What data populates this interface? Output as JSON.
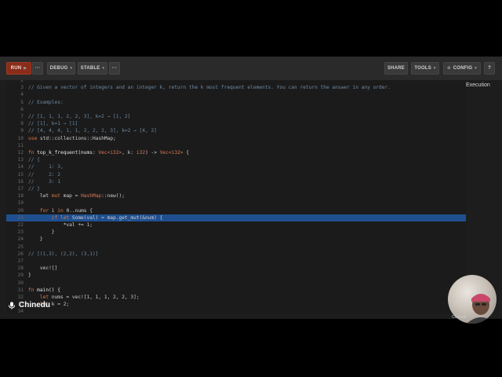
{
  "toolbar": {
    "run_label": "RUN",
    "run_icon": "play-icon",
    "more_label": "···",
    "debug_label": "DEBUG",
    "stable_label": "STABLE",
    "share_label": "SHARE",
    "tools_label": "TOOLS",
    "config_label": "CONFIG",
    "help_label": "?"
  },
  "side": {
    "execution_label": "Execution"
  },
  "participant": {
    "name": "Chinedu",
    "webcam_label": "Chinedu"
  },
  "highlighted_line": 21,
  "lines": [
    {
      "n": "2",
      "tokens": []
    },
    {
      "n": "3",
      "tokens": [
        {
          "t": "// Given a vector of integers and an integer k, return the k most frequent elements. You can return the answer in any order.",
          "c": "comment"
        }
      ]
    },
    {
      "n": "4",
      "tokens": []
    },
    {
      "n": "5",
      "tokens": [
        {
          "t": "// Examples:",
          "c": "comment"
        }
      ]
    },
    {
      "n": "6",
      "tokens": []
    },
    {
      "n": "7",
      "tokens": [
        {
          "t": "// [1, 1, 1, 2, 2, 3], k=2 → [1, 2]",
          "c": "comment"
        }
      ]
    },
    {
      "n": "8",
      "tokens": [
        {
          "t": "// [1], k=1 → [1]",
          "c": "comment"
        }
      ]
    },
    {
      "n": "9",
      "tokens": [
        {
          "t": "// [4, 4, 4, 1, 1, 2, 2, 2, 3], k=2 → [4, 2]",
          "c": "comment"
        }
      ]
    },
    {
      "n": "10",
      "tokens": [
        {
          "t": "use",
          "c": "kw"
        },
        {
          "t": " std::collections::HashMap;",
          "c": "plain"
        }
      ]
    },
    {
      "n": "11",
      "tokens": []
    },
    {
      "n": "12",
      "tokens": [
        {
          "t": "fn",
          "c": "kw"
        },
        {
          "t": " top_k_frequent(nums: ",
          "c": "fn"
        },
        {
          "t": "Vec<i32>",
          "c": "type"
        },
        {
          "t": ", k: ",
          "c": "plain"
        },
        {
          "t": "i32",
          "c": "type"
        },
        {
          "t": ") -> ",
          "c": "plain"
        },
        {
          "t": "Vec<i32>",
          "c": "type"
        },
        {
          "t": " {",
          "c": "plain"
        }
      ]
    },
    {
      "n": "13",
      "tokens": [
        {
          "t": "// {",
          "c": "comment"
        }
      ]
    },
    {
      "n": "14",
      "tokens": [
        {
          "t": "//     1: 3,",
          "c": "comment"
        }
      ]
    },
    {
      "n": "15",
      "tokens": [
        {
          "t": "//     2: 2",
          "c": "comment"
        }
      ]
    },
    {
      "n": "16",
      "tokens": [
        {
          "t": "//     3: 1",
          "c": "comment"
        }
      ]
    },
    {
      "n": "17",
      "tokens": [
        {
          "t": "// }",
          "c": "comment"
        }
      ]
    },
    {
      "n": "18",
      "tokens": [
        {
          "t": "    lwt ",
          "c": "plain"
        },
        {
          "t": "mut",
          "c": "kw"
        },
        {
          "t": " map = ",
          "c": "plain"
        },
        {
          "t": "HashMap",
          "c": "type"
        },
        {
          "t": "::new();",
          "c": "plain"
        }
      ]
    },
    {
      "n": "19",
      "tokens": []
    },
    {
      "n": "20",
      "tokens": [
        {
          "t": "    for",
          "c": "kw"
        },
        {
          "t": " i ",
          "c": "plain"
        },
        {
          "t": "in",
          "c": "kw"
        },
        {
          "t": " 0..nums {",
          "c": "plain"
        }
      ]
    },
    {
      "n": "21",
      "tokens": [
        {
          "t": "        if let",
          "c": "kw"
        },
        {
          "t": " Some(val) = map.get_mut(&num) {",
          "c": "plain"
        }
      ]
    },
    {
      "n": "22",
      "tokens": [
        {
          "t": "            *val += 1;",
          "c": "plain"
        }
      ]
    },
    {
      "n": "23",
      "tokens": [
        {
          "t": "        }",
          "c": "plain"
        }
      ]
    },
    {
      "n": "24",
      "tokens": [
        {
          "t": "    }",
          "c": "plain"
        }
      ]
    },
    {
      "n": "25",
      "tokens": []
    },
    {
      "n": "26",
      "tokens": [
        {
          "t": "// [(1,3), (2,2), (3,1)]",
          "c": "comment"
        }
      ]
    },
    {
      "n": "27",
      "tokens": []
    },
    {
      "n": "28",
      "tokens": [
        {
          "t": "    vec![]",
          "c": "plain"
        }
      ]
    },
    {
      "n": "29",
      "tokens": [
        {
          "t": "}",
          "c": "plain"
        }
      ]
    },
    {
      "n": "30",
      "tokens": []
    },
    {
      "n": "31",
      "tokens": [
        {
          "t": "fn",
          "c": "kw"
        },
        {
          "t": " main() {",
          "c": "fn"
        }
      ]
    },
    {
      "n": "32",
      "tokens": [
        {
          "t": "    let",
          "c": "kw"
        },
        {
          "t": " nums = vec![1, 1, 1, 2, 2, 3];",
          "c": "plain"
        }
      ]
    },
    {
      "n": "33",
      "tokens": [
        {
          "t": "    let",
          "c": "kw"
        },
        {
          "t": " k = 2;",
          "c": "plain"
        }
      ]
    },
    {
      "n": "34",
      "tokens": []
    }
  ]
}
